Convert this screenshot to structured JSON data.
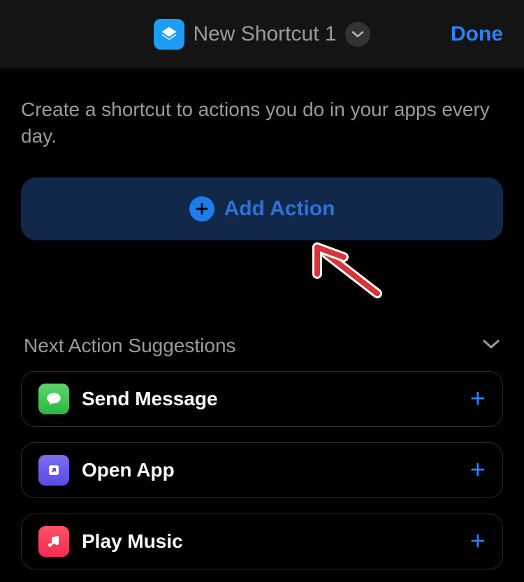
{
  "header": {
    "title": "New Shortcut 1",
    "done_label": "Done"
  },
  "description": "Create a shortcut to actions you do in your apps every day.",
  "add_action": {
    "label": "Add Action"
  },
  "suggestions": {
    "title": "Next Action Suggestions",
    "items": [
      {
        "label": "Send Message",
        "icon": "messages"
      },
      {
        "label": "Open App",
        "icon": "open-app"
      },
      {
        "label": "Play Music",
        "icon": "music"
      }
    ]
  },
  "colors": {
    "accent_blue": "#2d81f7",
    "accent_dark_blue": "#12284a",
    "text_secondary": "#9a9a9f"
  }
}
